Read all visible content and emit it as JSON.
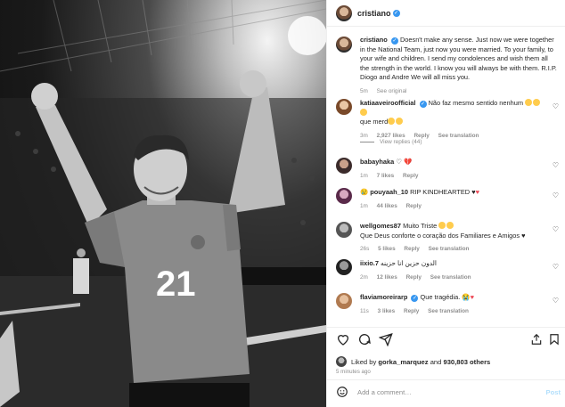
{
  "post": {
    "author": "cristiano",
    "caption": "Doesn't make any sense. Just now we were together in the National Team, just now you were married. To your family, to your wife and children. I send my condolences and wish them all the strength in the world. I know you will always be with them. R.I.P. Diogo and Andre We will all miss you.",
    "caption_time": "5m",
    "see_original": "See original",
    "jersey_number": "21"
  },
  "comments": [
    {
      "user": "katiaaveiroofficial",
      "text": "Não faz mesmo sentido nenhum",
      "text2": "que merd",
      "time": "3m",
      "likes": "2,927 likes",
      "reply": "Reply",
      "translate": "See translation",
      "view_replies": "View replies (44)",
      "verified": true
    },
    {
      "user": "babayhaka",
      "text": "♡",
      "time": "1m",
      "likes": "7 likes",
      "reply": "Reply"
    },
    {
      "user": "pouyaah_10",
      "text": "RIP KINDHEARTED",
      "time": "1m",
      "likes": "44 likes",
      "reply": "Reply"
    },
    {
      "user": "wellgomes87",
      "text": "Muito Triste",
      "text2": "Que Deus conforte o coração dos Familiares e Amigos",
      "time": "26s",
      "likes": "5 likes",
      "reply": "Reply",
      "translate": "See translation"
    },
    {
      "user": "iixio.7",
      "text": "الدون حزين انا حزينه",
      "time": "2m",
      "likes": "12 likes",
      "reply": "Reply",
      "translate": "See translation"
    },
    {
      "user": "flaviamoreirarp",
      "text": "Que tragédia.",
      "time": "11s",
      "likes": "3 likes",
      "reply": "Reply",
      "translate": "See translation"
    }
  ],
  "footer": {
    "liked_prefix": "Liked by",
    "liked_user": "gorka_marquez",
    "liked_and": "and",
    "liked_count": "930,803 others",
    "time": "5 minutes ago",
    "add_comment": "Add a comment…",
    "post_button": "Post"
  },
  "colors": {
    "verified": "#3897f0",
    "heart_red": "#ed4956",
    "muted": "#8e8e8e"
  }
}
